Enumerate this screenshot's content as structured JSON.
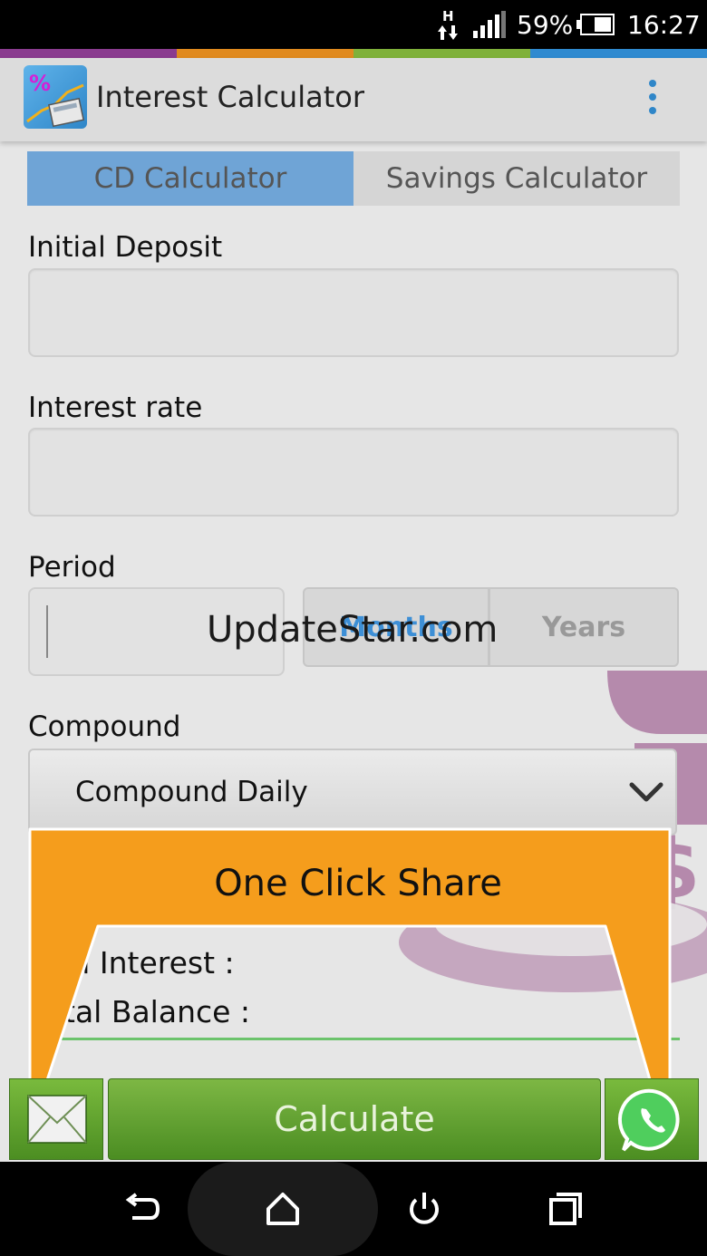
{
  "status_bar": {
    "network_type": "H",
    "battery_percent": "59%",
    "time": "16:27"
  },
  "colors": {
    "stripe": [
      "#8a3b8f",
      "#e08a1e",
      "#7fb13a",
      "#2f8ad0"
    ],
    "accent_tab": "#6fa4d6",
    "button_green": "#5a9c2c",
    "callout_orange": "#f59d1c"
  },
  "app_bar": {
    "title": "Interest Calculator",
    "logo_icon": "percent-calculator-icon",
    "overflow_icon": "more-vert-icon"
  },
  "tabs": [
    {
      "label": "CD Calculator",
      "active": true
    },
    {
      "label": "Savings Calculator",
      "active": false
    }
  ],
  "form": {
    "initial_deposit": {
      "label": "Initial Deposit",
      "value": ""
    },
    "interest_rate": {
      "label": "Interest rate",
      "value": ""
    },
    "period": {
      "label": "Period",
      "value": "",
      "units": [
        {
          "label": "Months",
          "selected": true
        },
        {
          "label": "Years",
          "selected": false
        }
      ]
    },
    "compound": {
      "label": "Compound",
      "selected": "Compound Daily"
    }
  },
  "watermark": "UpdateStar.com",
  "callout": {
    "text": "One Click Share"
  },
  "results": {
    "total_interest_label": "al Interest :",
    "total_balance_label": "tal Balance :"
  },
  "buttons": {
    "calculate": "Calculate",
    "mail_icon": "mail-icon",
    "whatsapp_icon": "whatsapp-icon"
  },
  "nav": [
    "back-icon",
    "home-icon",
    "power-icon",
    "recents-icon"
  ]
}
